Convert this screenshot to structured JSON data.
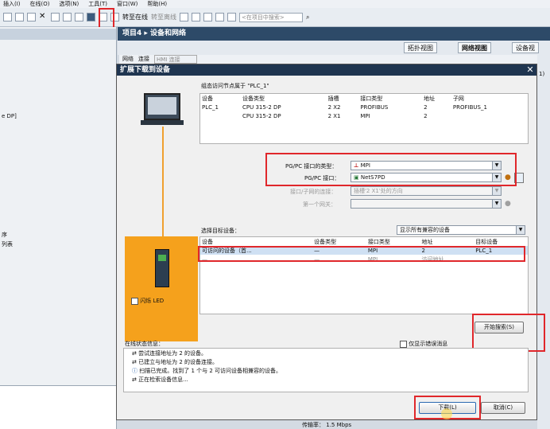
{
  "menu": [
    "插入(I)",
    "在线(O)",
    "选项(N)",
    "工具(T)",
    "窗口(W)",
    "帮助(H)"
  ],
  "toolbar": {
    "go_online": "转至在线",
    "go_offline": "转至离线",
    "search_placeholder": "<在项目中搜索>"
  },
  "left_pane": {
    "row_dp": "e DP]",
    "row_a": "序",
    "row_b": "列表"
  },
  "project_title": "项目4 ▸ 设备和网络",
  "view_tabs": [
    "拓扑视图",
    "网络视图",
    "设备视"
  ],
  "network_toolbar": {
    "network": "网络",
    "connect": "连接",
    "hmi_conn": "HMI 连接"
  },
  "dialog": {
    "title": "扩展下载到设备",
    "configured_label": "组态访问节点属于 \"PLC_1\"",
    "config_headers": [
      "设备",
      "设备类型",
      "插槽",
      "接口类型",
      "地址",
      "子网"
    ],
    "config_rows": [
      [
        "PLC_1",
        "CPU 315-2 DP",
        "2 X2",
        "PROFIBUS",
        "2",
        "PROFIBUS_1"
      ],
      [
        "",
        "CPU 315-2 DP",
        "2 X1",
        "MPI",
        "2",
        ""
      ]
    ],
    "pgpc_type_label": "PG/PC 接口的类型：",
    "pgpc_type_value": "MPI",
    "pgpc_iface_label": "PG/PC 接口：",
    "pgpc_iface_value": "NetS7PD",
    "subnet_conn_label": "接口/子网的连接：",
    "subnet_conn_value": "插槽'2 X1'处的方向",
    "gateway_label": "第一个网关：",
    "target_label": "选择目标设备：",
    "target_filter": "显示所有兼容的设备",
    "target_headers": [
      "设备",
      "设备类型",
      "接口类型",
      "地址",
      "目标设备"
    ],
    "target_rows": [
      [
        "可访问的设备（首...",
        "—",
        "MPI",
        "2",
        "PLC_1"
      ],
      [
        "—",
        "—",
        "MPI",
        "访问地址",
        ""
      ]
    ],
    "flash_led": "闪烁 LED",
    "start_search": "开始搜索(S)",
    "status_label": "在线状态信息：",
    "show_errors_only": "仅显示错误消息",
    "status_lines": [
      "尝试连接地址为 2 的设备。",
      "已建立与地址为 2 的设备连接。",
      "扫描已完成。找到了 1 个与 2 可访问设备相兼容的设备。",
      "正在检索设备信息..."
    ],
    "load_button": "下载(L)",
    "cancel_button": "取消(C)"
  },
  "bottom": {
    "baud_label": "传输率：",
    "baud_value": "1.5 Mbps"
  },
  "right_pane_label": "1)"
}
